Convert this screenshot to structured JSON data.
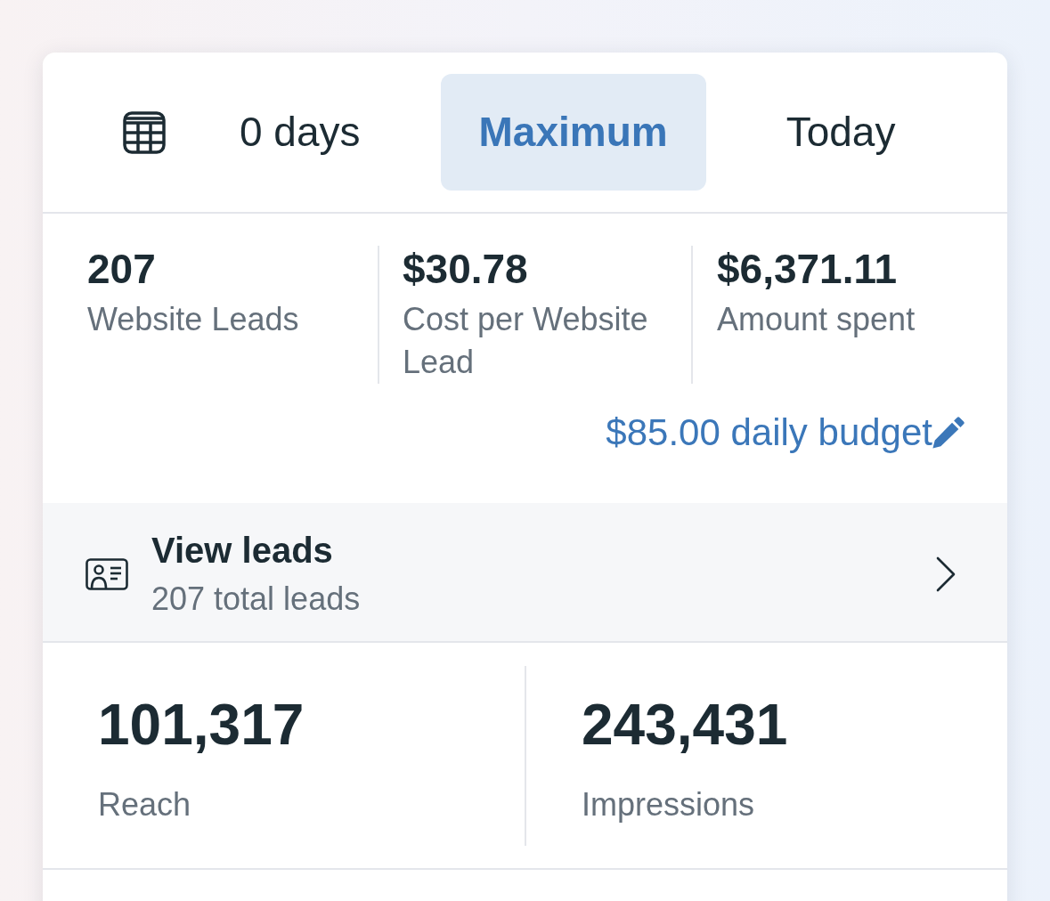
{
  "date_tabs": [
    {
      "label": "0 days",
      "selected": false
    },
    {
      "label": "Maximum",
      "selected": true
    },
    {
      "label": "Today",
      "selected": false
    }
  ],
  "summary_metrics": [
    {
      "value": "207",
      "label": "Website Leads"
    },
    {
      "value": "$30.78",
      "label": "Cost per Website Lead"
    },
    {
      "value": "$6,371.11",
      "label": "Amount spent"
    }
  ],
  "budget_link": "$85.00 daily budget",
  "leads_row": {
    "title": "View leads",
    "subtitle": "207 total leads"
  },
  "reach_metrics": [
    {
      "value": "101,317",
      "label": "Reach"
    },
    {
      "value": "243,431",
      "label": "Impressions"
    }
  ]
}
